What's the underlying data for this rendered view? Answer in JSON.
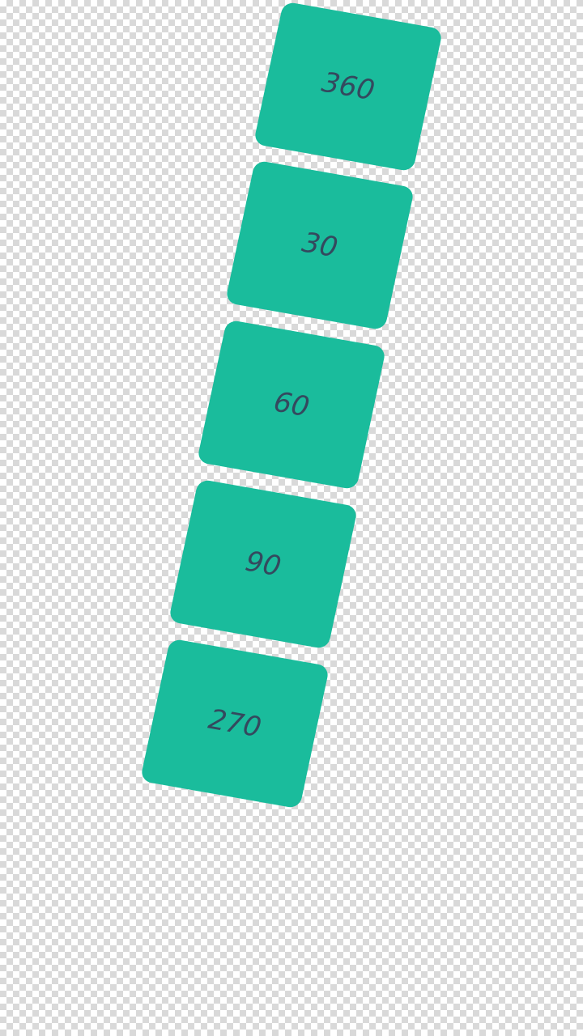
{
  "tiles": [
    {
      "label": "360"
    },
    {
      "label": "30"
    },
    {
      "label": "60"
    },
    {
      "label": "90"
    },
    {
      "label": "270"
    }
  ],
  "colors": {
    "tile": "#1abc9c",
    "label": "#34495e"
  }
}
